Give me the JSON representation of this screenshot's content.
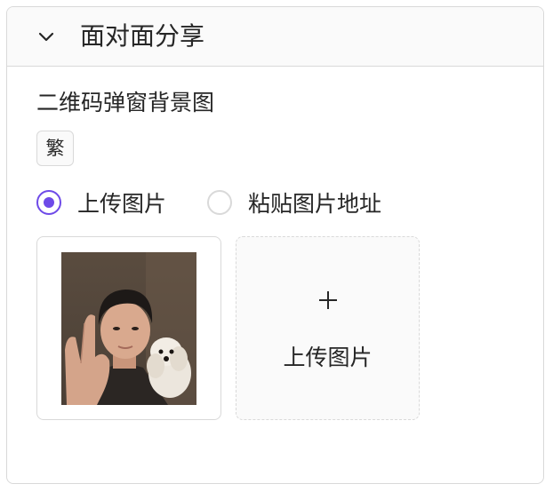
{
  "panel": {
    "title": "面对面分享",
    "collapse_icon": "chevron-down-icon"
  },
  "field": {
    "label": "二维码弹窗背景图",
    "lang_tag": "繁"
  },
  "source_options": [
    {
      "label": "上传图片",
      "checked": true
    },
    {
      "label": "粘贴图片地址",
      "checked": false
    }
  ],
  "uploaded_image": {
    "description_icon": "photo-thumbnail"
  },
  "upload_button": {
    "icon": "plus-icon",
    "label": "上传图片"
  },
  "colors": {
    "accent": "#6e4ae8",
    "border": "#d9d9d9",
    "header_bg": "#fafafa"
  }
}
